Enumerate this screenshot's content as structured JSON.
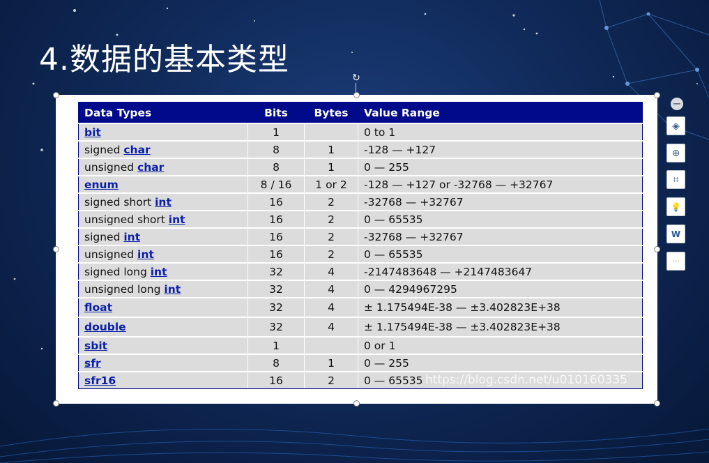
{
  "slide": {
    "title": "4.数据的基本类型"
  },
  "table": {
    "headers": [
      "Data Types",
      "Bits",
      "Bytes",
      "Value Range"
    ],
    "rows": [
      {
        "prefix": "",
        "kw": "bit",
        "bits": "1",
        "bytes": "",
        "range": "0 to 1"
      },
      {
        "prefix": "signed ",
        "kw": "char",
        "bits": "8",
        "bytes": "1",
        "range": "-128 — +127"
      },
      {
        "prefix": "unsigned ",
        "kw": "char",
        "bits": "8",
        "bytes": "1",
        "range": "0 — 255"
      },
      {
        "prefix": "",
        "kw": "enum",
        "bits": "8 / 16",
        "bytes": "1 or 2",
        "range": "-128 — +127 or -32768 — +32767"
      },
      {
        "prefix": "signed short ",
        "kw": "int",
        "bits": "16",
        "bytes": "2",
        "range": "-32768 — +32767"
      },
      {
        "prefix": "unsigned short ",
        "kw": "int",
        "bits": "16",
        "bytes": "2",
        "range": "0 — 65535"
      },
      {
        "prefix": "signed ",
        "kw": "int",
        "bits": "16",
        "bytes": "2",
        "range": "-32768 — +32767"
      },
      {
        "prefix": "unsigned ",
        "kw": "int",
        "bits": "16",
        "bytes": "2",
        "range": "0 — 65535"
      },
      {
        "prefix": "signed long ",
        "kw": "int",
        "bits": "32",
        "bytes": "4",
        "range": "-2147483648 — +2147483647"
      },
      {
        "prefix": "unsigned long ",
        "kw": "int",
        "bits": "32",
        "bytes": "4",
        "range": "0 — 4294967295"
      },
      {
        "prefix": "",
        "kw": "float",
        "bits": "32",
        "bytes": "4",
        "range": "± 1.175494E-38 — ±3.402823E+38"
      },
      {
        "prefix": "",
        "kw": "double",
        "bits": "32",
        "bytes": "4",
        "range": "± 1.175494E-38 — ±3.402823E+38"
      },
      {
        "prefix": "",
        "kw": "sbit",
        "bits": "1",
        "bytes": "",
        "range": "0 or 1"
      },
      {
        "prefix": "",
        "kw": "sfr",
        "bits": "8",
        "bytes": "1",
        "range": "0 — 255"
      },
      {
        "prefix": "",
        "kw": "sfr16",
        "bits": "16",
        "bytes": "2",
        "range": "0 — 65535"
      }
    ]
  },
  "watermark": "https://blog.csdn.net/u010160335",
  "toolbar": {
    "items": [
      {
        "name": "collapse-icon",
        "glyph": "−"
      },
      {
        "name": "layers-icon",
        "glyph": "◈"
      },
      {
        "name": "zoom-in-icon",
        "glyph": "⊕"
      },
      {
        "name": "crop-icon",
        "glyph": "⌗"
      },
      {
        "name": "idea-bulb-icon",
        "glyph": "💡"
      },
      {
        "name": "word-export-icon",
        "glyph": "W"
      },
      {
        "name": "more-icon",
        "glyph": "···"
      }
    ]
  },
  "colors": {
    "header_bg": "#000a8a",
    "row_bg": "#dcdcdc",
    "keyword": "#0b1fa8",
    "more_dots": "#e07a2e"
  }
}
